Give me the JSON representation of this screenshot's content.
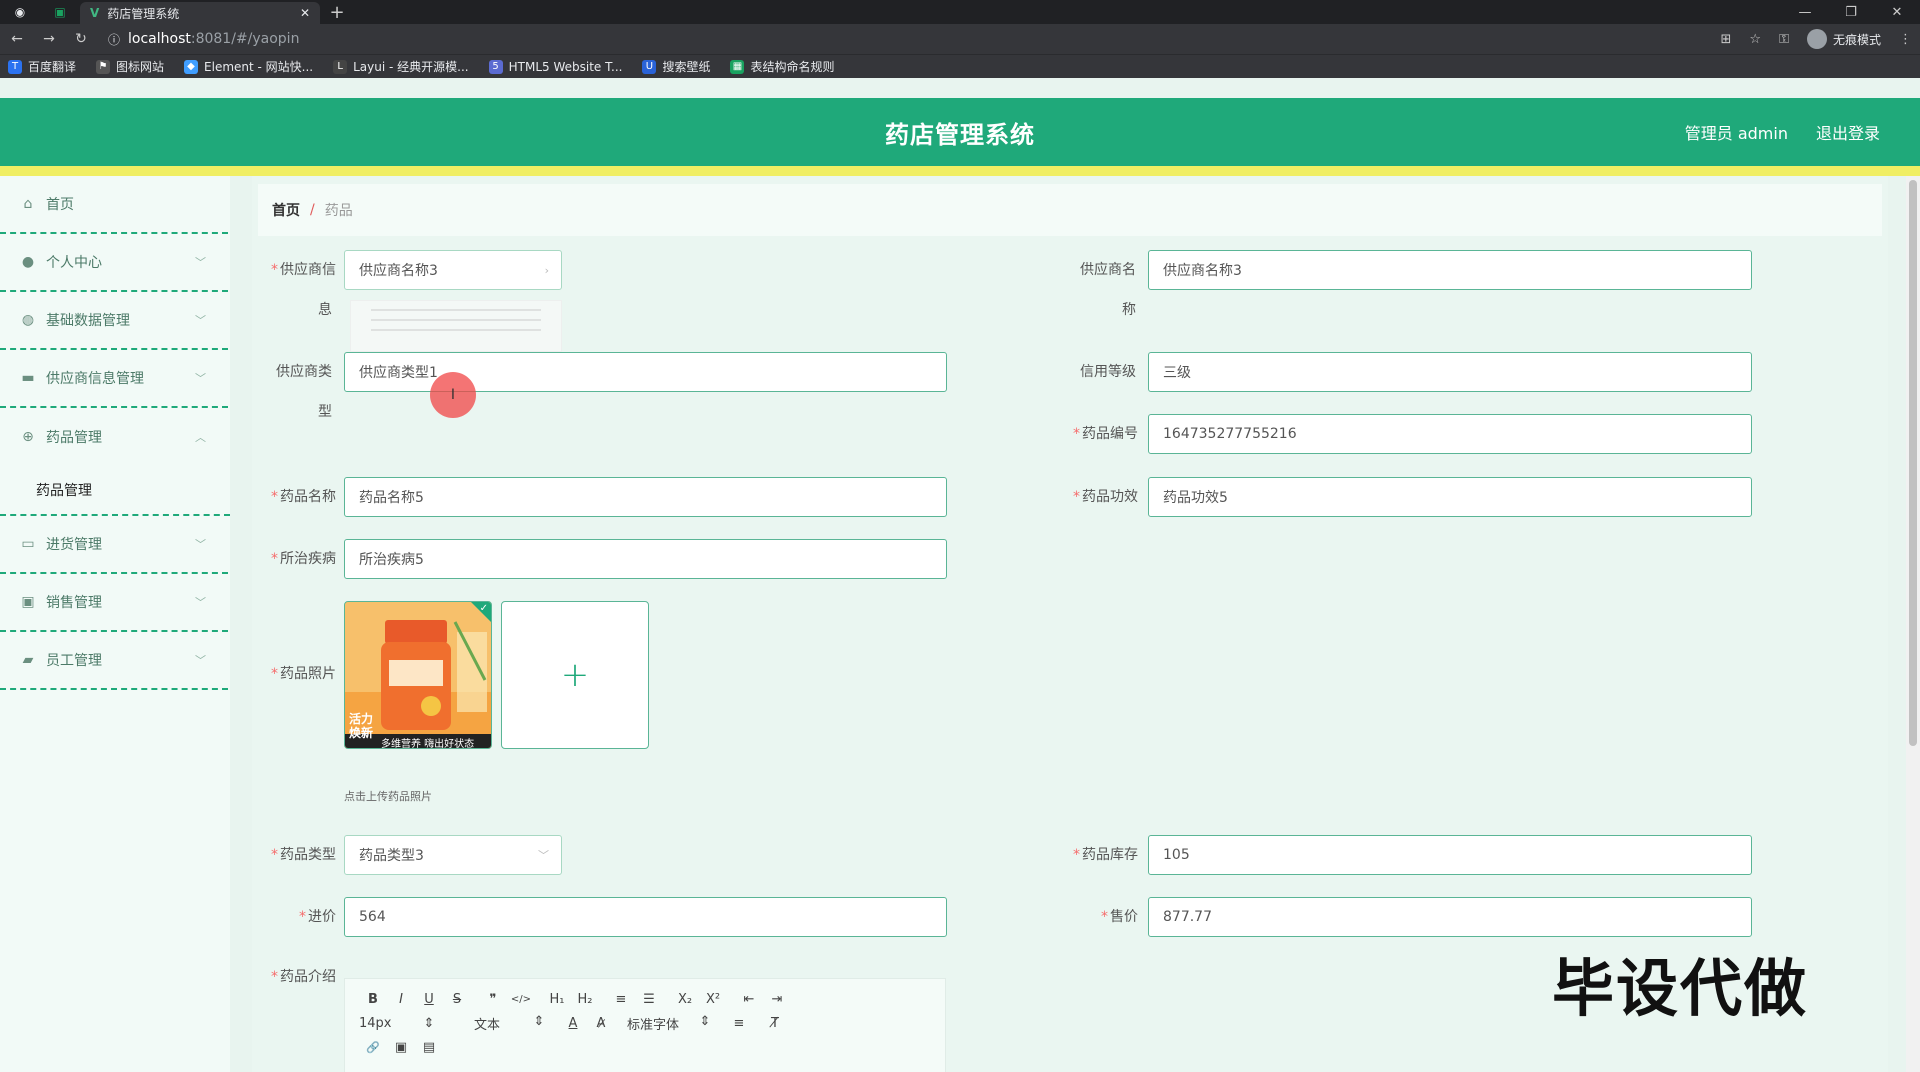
{
  "browser": {
    "tab_title": "药店管理系统",
    "url_host": "localhost",
    "url_path": ":8081/#/yaopin",
    "profile_label": "无痕模式",
    "bookmarks": [
      {
        "label": "百度翻译",
        "color": "#2b72f0",
        "icon": "translate-icon"
      },
      {
        "label": "图标网站",
        "color": "#333333",
        "icon": "flag-icon"
      },
      {
        "label": "Element - 网站快...",
        "color": "#409eff",
        "icon": "element-icon"
      },
      {
        "label": "Layui - 经典开源模...",
        "color": "#444444",
        "icon": "layui-icon"
      },
      {
        "label": "HTML5 Website T...",
        "color": "#5b6bd1",
        "icon": "html5-icon"
      },
      {
        "label": "搜索壁纸",
        "color": "#2a63d8",
        "icon": "wallpaper-icon"
      },
      {
        "label": "表结构命名规则",
        "color": "#1aa260",
        "icon": "sheet-icon"
      }
    ]
  },
  "header": {
    "title": "药店管理系统",
    "user": "管理员 admin",
    "logout": "退出登录"
  },
  "sidebar": {
    "home": "首页",
    "items": [
      {
        "label": "个人中心",
        "icon": "user-icon"
      },
      {
        "label": "基础数据管理",
        "icon": "data-icon"
      },
      {
        "label": "供应商信息管理",
        "icon": "supplier-icon"
      },
      {
        "label": "药品管理",
        "icon": "medicine-icon",
        "expanded": true
      },
      {
        "label": "进货管理",
        "icon": "purchase-icon"
      },
      {
        "label": "销售管理",
        "icon": "sales-icon"
      },
      {
        "label": "员工管理",
        "icon": "staff-icon"
      }
    ],
    "sub_item": "药品管理"
  },
  "breadcrumb": {
    "home": "首页",
    "sep": "/",
    "current": "药品"
  },
  "form": {
    "supplier_info": {
      "label_line1": "供应商信",
      "label_line2": "息",
      "value": "供应商名称3"
    },
    "supplier_name": {
      "label_line1": "供应商名",
      "label_line2": "称",
      "value": "供应商名称3"
    },
    "supplier_type": {
      "label_line1": "供应商类",
      "label_line2": "型",
      "value": "供应商类型1"
    },
    "credit_level": {
      "label": "信用等级",
      "value": "三级"
    },
    "drug_code": {
      "label": "药品编号",
      "value": "164735277755216"
    },
    "drug_name": {
      "label": "药品名称",
      "value": "药品名称5"
    },
    "drug_effect": {
      "label": "药品功效",
      "value": "药品功效5"
    },
    "disease": {
      "label": "所治疾病",
      "value": "所治疾病5"
    },
    "photo": {
      "label": "药品照片",
      "hint": "点击上传药品照片",
      "thumb_text_1": "活力",
      "thumb_text_2": "焕新",
      "thumb_caption": "多维营养 嗨出好状态"
    },
    "drug_type": {
      "label": "药品类型",
      "value": "药品类型3"
    },
    "stock": {
      "label": "药品库存",
      "value": "105"
    },
    "purchase_price": {
      "label": "进价",
      "value": "564"
    },
    "sale_price": {
      "label": "售价",
      "value": "877.77"
    },
    "intro": {
      "label": "药品介绍"
    }
  },
  "editor": {
    "row1": [
      "B",
      "I",
      "U",
      "S",
      "❞",
      "</>",
      "H₁",
      "H₂",
      "≡",
      "☰",
      "X₂",
      "X²",
      "⇤",
      "⇥"
    ],
    "font_size": "14px",
    "text_style": "文本",
    "font_family": "标准字体",
    "row2_icons": [
      "A",
      "A̷",
      "≡",
      "T̸"
    ],
    "row3": [
      "🔗",
      "▣",
      "▤"
    ]
  },
  "watermark": "毕设代做"
}
